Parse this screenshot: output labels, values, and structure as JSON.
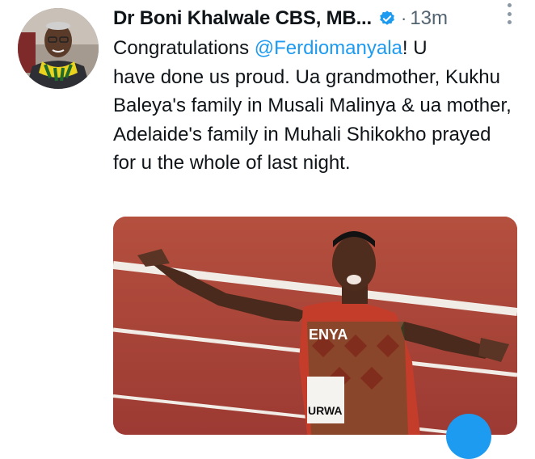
{
  "author": {
    "name": "Dr Boni Khalwale CBS, MB...",
    "avatar": "profile-photo",
    "verified": true
  },
  "meta": {
    "separator": "·",
    "time": "13m"
  },
  "tweet": {
    "line1_prefix": "Congratulations ",
    "mention": "@Ferdiomanyala",
    "line1_suffix": "! U",
    "rest": "have done us proud. Ua grandmother, Kukhu Baleya's family in Musali Malinya & ua mother, Adelaide's family in Muhali Shikokho prayed for u the whole of last night."
  },
  "media": {
    "bib_text": "URWA",
    "jersey_text": "ENYA"
  },
  "colors": {
    "accent": "#1d9bf0",
    "text": "#0f1419",
    "muted": "#536471"
  }
}
